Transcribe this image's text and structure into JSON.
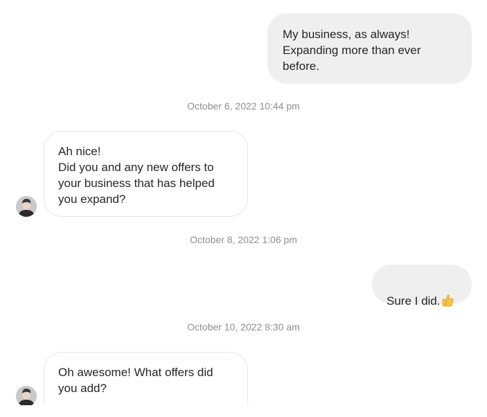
{
  "messages": [
    {
      "type": "sent",
      "text": "My business, as always!\nExpanding more than ever\nbefore."
    },
    {
      "type": "timestamp",
      "text": "October 6, 2022 10:44 pm"
    },
    {
      "type": "received",
      "text": "Ah nice!\nDid you and any new offers to\nyour business that has helped\nyou expand?"
    },
    {
      "type": "timestamp",
      "text": "October 8, 2022 1:06 pm"
    },
    {
      "type": "sent",
      "text": "Sure I did.",
      "emoji": "thumbs-up-icon"
    },
    {
      "type": "timestamp",
      "text": "October 10, 2022 8:30 am"
    },
    {
      "type": "received",
      "text": "Oh awesome! What offers did\nyou add?"
    }
  ],
  "colors": {
    "sent_bubble": "#efefef",
    "received_border": "#e6e6e6",
    "timestamp_text": "#8e8e8e",
    "message_text": "#262626"
  }
}
